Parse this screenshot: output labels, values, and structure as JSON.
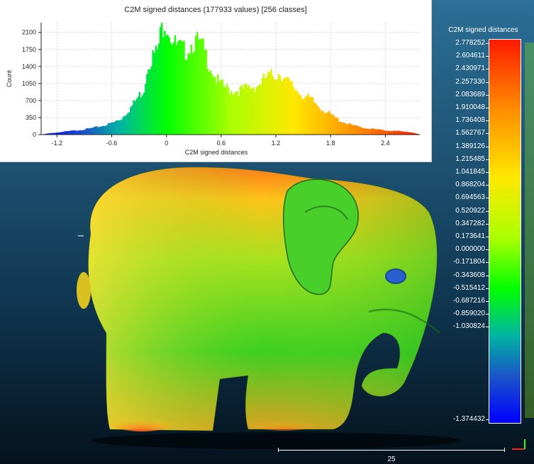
{
  "histogram": {
    "title": "C2M signed distances (177933 values)  [256 classes]",
    "xlabel": "C2M signed distances",
    "ylabel": "Count"
  },
  "colorscale": {
    "title": "C2M signed distances",
    "labels": [
      "2.778252",
      "2.604611",
      "2.430971",
      "2.257330",
      "2.083689",
      "1.910048",
      "1.736408",
      "1.562767",
      "1.389126",
      "1.215485",
      "1.041845",
      "0.868204",
      "0.694563",
      "0.520922",
      "0.347282",
      "0.173641",
      "0.000000",
      "-0.171804",
      "-0.343608",
      "-0.515412",
      "-0.687216",
      "-0.859020",
      "-1.030824",
      "-1.374432"
    ]
  },
  "scale_bar": {
    "value": "25"
  },
  "colors": {
    "background_top": "#2c6f97",
    "background_bottom": "#04121d",
    "accent_axis": "#ff2020"
  },
  "chart_data": {
    "type": "bar",
    "title": "C2M signed distances (177933 values)  [256 classes]",
    "xlabel": "C2M signed distances",
    "ylabel": "Count",
    "xlim": [
      -1.374,
      2.778
    ],
    "ylim": [
      0,
      2300
    ],
    "xticks": [
      -1.2,
      -0.6,
      0,
      0.6,
      1.2,
      1.8,
      2.4
    ],
    "yticks": [
      0,
      350,
      700,
      1050,
      1400,
      1750,
      2100
    ],
    "grid": true,
    "points": [
      [
        -1.374,
        0
      ],
      [
        -1.3,
        20
      ],
      [
        -1.2,
        40
      ],
      [
        -1.1,
        60
      ],
      [
        -1.0,
        80
      ],
      [
        -0.9,
        100
      ],
      [
        -0.8,
        130
      ],
      [
        -0.7,
        170
      ],
      [
        -0.6,
        220
      ],
      [
        -0.5,
        300
      ],
      [
        -0.4,
        500
      ],
      [
        -0.3,
        750
      ],
      [
        -0.25,
        850
      ],
      [
        -0.2,
        1400
      ],
      [
        -0.15,
        1500
      ],
      [
        -0.1,
        1600
      ],
      [
        -0.05,
        2050
      ],
      [
        -0.02,
        2200
      ],
      [
        0.0,
        2150
      ],
      [
        0.05,
        1900
      ],
      [
        0.1,
        1700
      ],
      [
        0.15,
        1650
      ],
      [
        0.2,
        1600
      ],
      [
        0.25,
        1700
      ],
      [
        0.3,
        1800
      ],
      [
        0.35,
        1750
      ],
      [
        0.4,
        1650
      ],
      [
        0.45,
        1450
      ],
      [
        0.5,
        1250
      ],
      [
        0.55,
        1050
      ],
      [
        0.6,
        950
      ],
      [
        0.7,
        850
      ],
      [
        0.8,
        850
      ],
      [
        0.9,
        900
      ],
      [
        1.0,
        950
      ],
      [
        1.1,
        1100
      ],
      [
        1.2,
        1150
      ],
      [
        1.25,
        1200
      ],
      [
        1.3,
        1050
      ],
      [
        1.4,
        900
      ],
      [
        1.5,
        750
      ],
      [
        1.6,
        650
      ],
      [
        1.7,
        500
      ],
      [
        1.8,
        380
      ],
      [
        1.9,
        270
      ],
      [
        2.0,
        200
      ],
      [
        2.1,
        150
      ],
      [
        2.2,
        120
      ],
      [
        2.3,
        100
      ],
      [
        2.4,
        80
      ],
      [
        2.5,
        70
      ],
      [
        2.6,
        60
      ],
      [
        2.7,
        40
      ],
      [
        2.778,
        0
      ]
    ]
  }
}
